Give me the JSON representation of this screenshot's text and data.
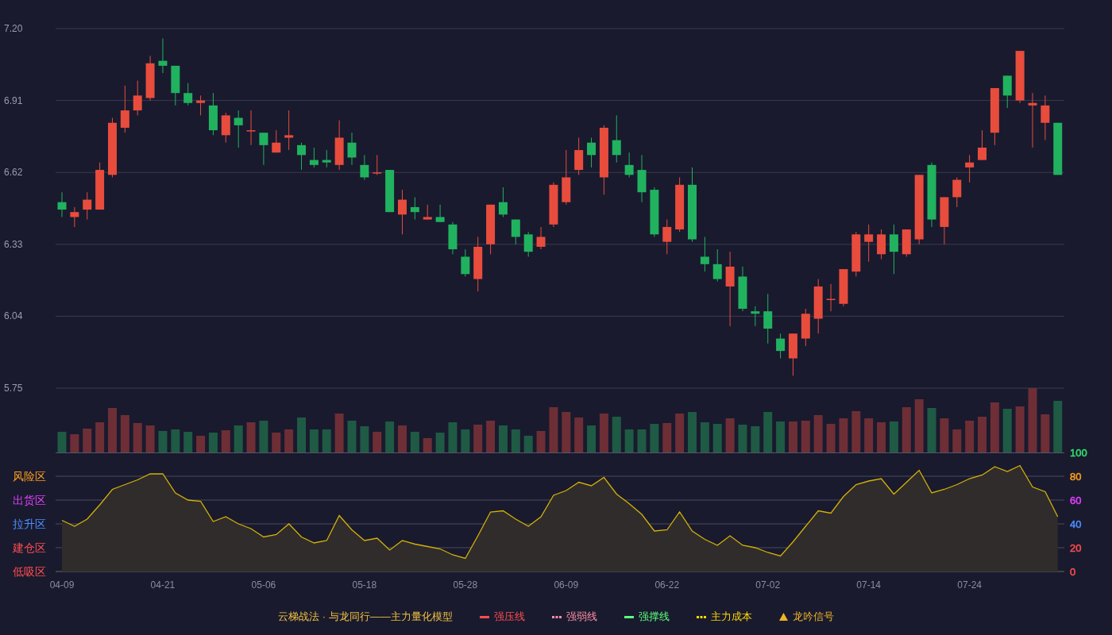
{
  "price_chart": {
    "chart_data": {
      "type": "candlestick",
      "ylim": [
        5.75,
        7.2
      ],
      "yticks": [
        {
          "value": 7.2,
          "label": "7.20"
        },
        {
          "value": 6.91,
          "label": "6.91"
        },
        {
          "value": 6.62,
          "label": "6.62"
        },
        {
          "value": 6.33,
          "label": "6.33"
        },
        {
          "value": 6.04,
          "label": "6.04"
        },
        {
          "value": 5.75,
          "label": "5.75"
        }
      ],
      "grid": true,
      "categories": [
        null,
        null,
        null,
        null,
        null,
        null,
        null,
        null,
        null,
        null,
        null,
        null,
        null,
        null,
        null,
        null,
        null,
        null,
        null,
        null,
        null,
        null,
        null,
        null,
        null,
        null,
        null,
        null,
        null,
        null,
        null,
        null,
        null,
        null,
        null,
        null,
        null,
        null,
        null,
        null,
        null,
        null,
        null,
        null,
        null,
        null,
        null,
        null,
        null,
        null,
        null,
        null,
        null,
        null,
        null,
        null,
        null,
        null,
        null,
        null,
        null,
        null,
        null,
        null,
        null,
        null,
        null,
        null,
        null,
        null,
        null,
        null,
        null,
        null,
        null,
        null,
        null,
        null,
        null,
        null
      ],
      "ohlc": [
        [
          6.5,
          6.54,
          6.44,
          6.47
        ],
        [
          6.44,
          6.48,
          6.4,
          6.46
        ],
        [
          6.47,
          6.54,
          6.43,
          6.51
        ],
        [
          6.47,
          6.66,
          6.47,
          6.63
        ],
        [
          6.61,
          6.84,
          6.6,
          6.82
        ],
        [
          6.8,
          6.97,
          6.78,
          6.87
        ],
        [
          6.87,
          6.99,
          6.85,
          6.93
        ],
        [
          6.92,
          7.09,
          6.91,
          7.06
        ],
        [
          7.07,
          7.16,
          7.02,
          7.05
        ],
        [
          7.05,
          7.05,
          6.89,
          6.94
        ],
        [
          6.94,
          6.98,
          6.89,
          6.9
        ],
        [
          6.9,
          6.93,
          6.85,
          6.91
        ],
        [
          6.89,
          6.94,
          6.77,
          6.79
        ],
        [
          6.77,
          6.86,
          6.74,
          6.85
        ],
        [
          6.84,
          6.87,
          6.72,
          6.81
        ],
        [
          6.79,
          6.87,
          6.73,
          6.79
        ],
        [
          6.78,
          6.78,
          6.65,
          6.73
        ],
        [
          6.7,
          6.79,
          6.7,
          6.74
        ],
        [
          6.76,
          6.87,
          6.71,
          6.77
        ],
        [
          6.73,
          6.74,
          6.63,
          6.69
        ],
        [
          6.67,
          6.72,
          6.64,
          6.65
        ],
        [
          6.67,
          6.71,
          6.64,
          6.66
        ],
        [
          6.65,
          6.83,
          6.63,
          6.76
        ],
        [
          6.74,
          6.78,
          6.65,
          6.68
        ],
        [
          6.65,
          6.69,
          6.59,
          6.6
        ],
        [
          6.62,
          6.69,
          6.61,
          6.62
        ],
        [
          6.63,
          6.63,
          6.46,
          6.46
        ],
        [
          6.45,
          6.55,
          6.37,
          6.51
        ],
        [
          6.48,
          6.52,
          6.43,
          6.46
        ],
        [
          6.43,
          6.49,
          6.43,
          6.44
        ],
        [
          6.44,
          6.49,
          6.42,
          6.42
        ],
        [
          6.41,
          6.42,
          6.29,
          6.31
        ],
        [
          6.28,
          6.31,
          6.2,
          6.21
        ],
        [
          6.19,
          6.36,
          6.14,
          6.32
        ],
        [
          6.33,
          6.49,
          6.29,
          6.49
        ],
        [
          6.5,
          6.56,
          6.44,
          6.45
        ],
        [
          6.43,
          6.43,
          6.33,
          6.36
        ],
        [
          6.37,
          6.38,
          6.28,
          6.3
        ],
        [
          6.32,
          6.4,
          6.31,
          6.36
        ],
        [
          6.41,
          6.58,
          6.4,
          6.57
        ],
        [
          6.5,
          6.71,
          6.49,
          6.6
        ],
        [
          6.63,
          6.76,
          6.61,
          6.71
        ],
        [
          6.74,
          6.76,
          6.64,
          6.69
        ],
        [
          6.6,
          6.81,
          6.53,
          6.8
        ],
        [
          6.75,
          6.85,
          6.66,
          6.69
        ],
        [
          6.65,
          6.7,
          6.6,
          6.61
        ],
        [
          6.63,
          6.69,
          6.5,
          6.54
        ],
        [
          6.55,
          6.56,
          6.36,
          6.37
        ],
        [
          6.34,
          6.43,
          6.29,
          6.4
        ],
        [
          6.39,
          6.6,
          6.38,
          6.57
        ],
        [
          6.57,
          6.64,
          6.34,
          6.35
        ],
        [
          6.28,
          6.36,
          6.22,
          6.25
        ],
        [
          6.25,
          6.31,
          6.18,
          6.19
        ],
        [
          6.16,
          6.3,
          6.0,
          6.24
        ],
        [
          6.2,
          6.24,
          6.06,
          6.07
        ],
        [
          6.06,
          6.08,
          6.0,
          6.05
        ],
        [
          6.06,
          6.13,
          5.93,
          5.99
        ],
        [
          5.95,
          5.97,
          5.87,
          5.9
        ],
        [
          5.87,
          5.97,
          5.8,
          5.97
        ],
        [
          5.95,
          6.07,
          5.92,
          6.05
        ],
        [
          6.03,
          6.19,
          5.97,
          6.16
        ],
        [
          6.11,
          6.17,
          6.06,
          6.11
        ],
        [
          6.09,
          6.23,
          6.08,
          6.23
        ],
        [
          6.22,
          6.38,
          6.2,
          6.37
        ],
        [
          6.34,
          6.41,
          6.26,
          6.37
        ],
        [
          6.29,
          6.39,
          6.27,
          6.37
        ],
        [
          6.37,
          6.41,
          6.21,
          6.3
        ],
        [
          6.29,
          6.39,
          6.28,
          6.39
        ],
        [
          6.35,
          6.61,
          6.33,
          6.61
        ],
        [
          6.65,
          6.66,
          6.4,
          6.43
        ],
        [
          6.4,
          6.52,
          6.33,
          6.52
        ],
        [
          6.52,
          6.6,
          6.48,
          6.59
        ],
        [
          6.64,
          6.69,
          6.58,
          6.66
        ],
        [
          6.67,
          6.79,
          6.67,
          6.72
        ],
        [
          6.78,
          6.96,
          6.73,
          6.96
        ],
        [
          7.01,
          7.01,
          6.88,
          6.93
        ],
        [
          6.91,
          7.11,
          6.9,
          7.11
        ],
        [
          6.89,
          6.94,
          6.72,
          6.9
        ],
        [
          6.82,
          6.93,
          6.75,
          6.89
        ],
        [
          6.82,
          6.82,
          6.61,
          6.61
        ]
      ]
    }
  },
  "indicator": {
    "chart_data": {
      "type": "area",
      "grid": true,
      "ylim": [
        0,
        100
      ],
      "yticks": [
        100,
        80,
        60,
        40,
        20,
        0
      ],
      "categories": [
        "04-09",
        null,
        null,
        null,
        null,
        null,
        null,
        null,
        "04-21",
        null,
        null,
        null,
        null,
        null,
        null,
        null,
        "05-06",
        null,
        null,
        null,
        null,
        null,
        null,
        null,
        "05-18",
        null,
        null,
        null,
        null,
        null,
        null,
        null,
        "05-28",
        null,
        null,
        null,
        null,
        null,
        null,
        null,
        "06-09",
        null,
        null,
        null,
        null,
        null,
        null,
        null,
        "06-22",
        null,
        null,
        null,
        null,
        null,
        null,
        null,
        "07-02",
        null,
        null,
        null,
        null,
        null,
        null,
        null,
        "07-14",
        null,
        null,
        null,
        null,
        null,
        null,
        null,
        "07-24",
        null,
        null,
        null,
        null,
        null,
        null,
        null
      ],
      "series": [
        {
          "color": "#d4b106",
          "values": [
            43,
            38,
            44,
            56,
            69,
            73,
            77,
            82,
            82,
            66,
            60,
            59,
            42,
            46,
            40,
            36,
            29,
            31,
            40,
            29,
            24,
            26,
            47,
            35,
            26,
            28,
            18,
            26,
            23,
            21,
            19,
            14,
            11,
            30,
            50,
            51,
            44,
            38,
            46,
            64,
            68,
            75,
            72,
            79,
            65,
            57,
            48,
            34,
            35,
            50,
            34,
            27,
            22,
            30,
            22,
            20,
            16,
            13,
            25,
            38,
            51,
            49,
            63,
            73,
            76,
            78,
            65,
            75,
            85,
            66,
            69,
            73,
            78,
            81,
            88,
            84,
            89,
            71,
            67,
            46
          ]
        }
      ]
    },
    "axis_labels": [
      {
        "label": "100",
        "color": "#33e06a"
      },
      {
        "label": "80",
        "color": "#ff9f1a"
      },
      {
        "label": "60",
        "color": "#e040fb"
      },
      {
        "label": "40",
        "color": "#4d8dff"
      },
      {
        "label": "20",
        "color": "#ff4d4f"
      },
      {
        "label": "0",
        "color": "#ff4d4f"
      }
    ],
    "zones": [
      {
        "label": "风险区",
        "color": "#ff9f1a"
      },
      {
        "label": "出货区",
        "color": "#e040fb"
      },
      {
        "label": "拉升区",
        "color": "#4d8dff"
      },
      {
        "label": "建仓区",
        "color": "#ff4d4f"
      },
      {
        "label": "低吸区",
        "color": "#ff4d4f"
      }
    ]
  },
  "legend": {
    "title": "云梯战法 · 与龙同行——主力量化模型",
    "items": [
      {
        "label": "强压线",
        "kind": "solid",
        "color": "#ff4d4f"
      },
      {
        "label": "强弱线",
        "kind": "dashed",
        "color": "#ff8fa3"
      },
      {
        "label": "强撑线",
        "kind": "solid",
        "color": "#5cff7a"
      },
      {
        "label": "主力成本",
        "kind": "dashed",
        "color": "#ffd700"
      },
      {
        "label": "龙吟信号",
        "kind": "triangle",
        "color": "#f0b429"
      }
    ]
  }
}
